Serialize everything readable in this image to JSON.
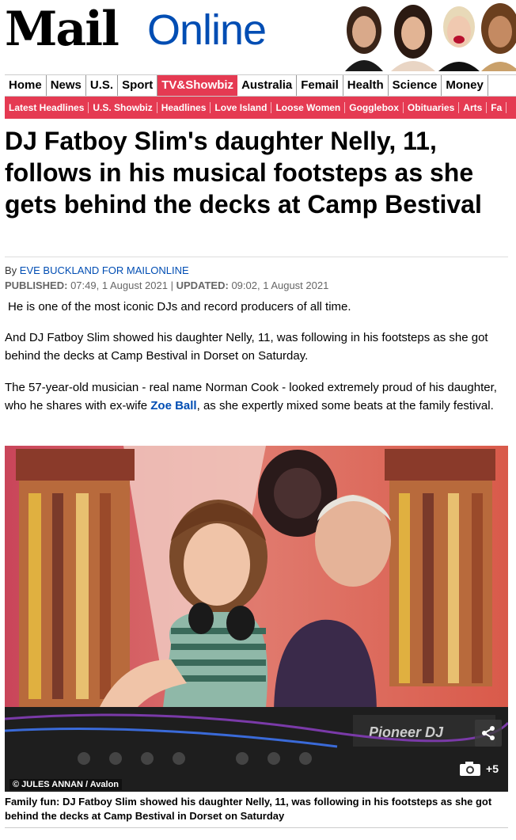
{
  "masthead": {
    "logo_mail": "Mail",
    "logo_online": "Online"
  },
  "nav": {
    "items": [
      "Home",
      "News",
      "U.S.",
      "Sport",
      "TV&Showbiz",
      "Australia",
      "Femail",
      "Health",
      "Science",
      "Money"
    ],
    "active": "TV&Showbiz"
  },
  "subnav": {
    "items": [
      "Latest Headlines",
      "U.S. Showbiz",
      "Headlines",
      "Love Island",
      "Loose Women",
      "Gogglebox",
      "Obituaries",
      "Arts",
      "Fa"
    ]
  },
  "article": {
    "headline": "DJ Fatboy Slim's daughter Nelly, 11, follows in his musical footsteps as she gets behind the decks at Camp Bestival",
    "by_prefix": "By",
    "author": "EVE BUCKLAND FOR MAILONLINE",
    "published_label": "PUBLISHED:",
    "published": "07:49, 1 August 2021",
    "sep": "|",
    "updated_label": "UPDATED:",
    "updated": "09:02, 1 August 2021",
    "para1": "He is one of the most iconic DJs and record producers of all time.",
    "para2": "And DJ Fatboy Slim showed his daughter Nelly, 11, was following in his footsteps as she got behind the decks at Camp Bestival in Dorset on Saturday.",
    "para3_before": "The 57-year-old musician - real name Norman Cook - looked extremely proud of his daughter, who he shares with ex-wife ",
    "para3_link": "Zoe Ball",
    "para3_after": ", as she expertly mixed some beats at the family festival."
  },
  "photo": {
    "credit": "© JULES ANNAN / Avalon",
    "gallery_count": "+5",
    "deck_brand": "Pioneer DJ",
    "caption": "Family fun: DJ Fatboy Slim showed his daughter Nelly, 11, was following in his footsteps as she got behind the decks at Camp Bestival in Dorset on Saturday"
  },
  "colors": {
    "brand_red": "#e53a52",
    "link_blue": "#004db3"
  }
}
